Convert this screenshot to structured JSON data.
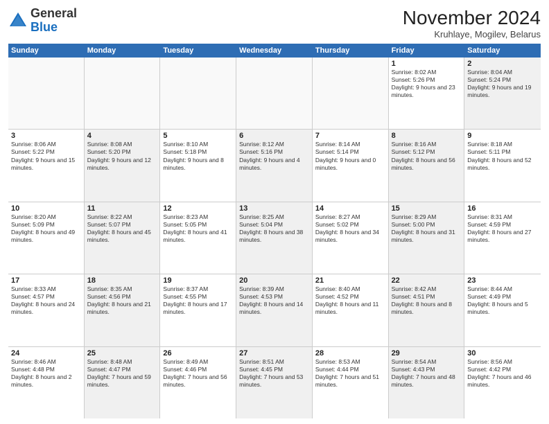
{
  "header": {
    "logo_general": "General",
    "logo_blue": "Blue",
    "month_title": "November 2024",
    "subtitle": "Kruhlaye, Mogilev, Belarus"
  },
  "days_of_week": [
    "Sunday",
    "Monday",
    "Tuesday",
    "Wednesday",
    "Thursday",
    "Friday",
    "Saturday"
  ],
  "rows": [
    [
      {
        "day": "",
        "info": "",
        "shaded": false,
        "empty": true
      },
      {
        "day": "",
        "info": "",
        "shaded": false,
        "empty": true
      },
      {
        "day": "",
        "info": "",
        "shaded": false,
        "empty": true
      },
      {
        "day": "",
        "info": "",
        "shaded": false,
        "empty": true
      },
      {
        "day": "",
        "info": "",
        "shaded": false,
        "empty": true
      },
      {
        "day": "1",
        "info": "Sunrise: 8:02 AM\nSunset: 5:26 PM\nDaylight: 9 hours and 23 minutes.",
        "shaded": false,
        "empty": false
      },
      {
        "day": "2",
        "info": "Sunrise: 8:04 AM\nSunset: 5:24 PM\nDaylight: 9 hours and 19 minutes.",
        "shaded": true,
        "empty": false
      }
    ],
    [
      {
        "day": "3",
        "info": "Sunrise: 8:06 AM\nSunset: 5:22 PM\nDaylight: 9 hours and 15 minutes.",
        "shaded": false,
        "empty": false
      },
      {
        "day": "4",
        "info": "Sunrise: 8:08 AM\nSunset: 5:20 PM\nDaylight: 9 hours and 12 minutes.",
        "shaded": true,
        "empty": false
      },
      {
        "day": "5",
        "info": "Sunrise: 8:10 AM\nSunset: 5:18 PM\nDaylight: 9 hours and 8 minutes.",
        "shaded": false,
        "empty": false
      },
      {
        "day": "6",
        "info": "Sunrise: 8:12 AM\nSunset: 5:16 PM\nDaylight: 9 hours and 4 minutes.",
        "shaded": true,
        "empty": false
      },
      {
        "day": "7",
        "info": "Sunrise: 8:14 AM\nSunset: 5:14 PM\nDaylight: 9 hours and 0 minutes.",
        "shaded": false,
        "empty": false
      },
      {
        "day": "8",
        "info": "Sunrise: 8:16 AM\nSunset: 5:12 PM\nDaylight: 8 hours and 56 minutes.",
        "shaded": true,
        "empty": false
      },
      {
        "day": "9",
        "info": "Sunrise: 8:18 AM\nSunset: 5:11 PM\nDaylight: 8 hours and 52 minutes.",
        "shaded": false,
        "empty": false
      }
    ],
    [
      {
        "day": "10",
        "info": "Sunrise: 8:20 AM\nSunset: 5:09 PM\nDaylight: 8 hours and 49 minutes.",
        "shaded": false,
        "empty": false
      },
      {
        "day": "11",
        "info": "Sunrise: 8:22 AM\nSunset: 5:07 PM\nDaylight: 8 hours and 45 minutes.",
        "shaded": true,
        "empty": false
      },
      {
        "day": "12",
        "info": "Sunrise: 8:23 AM\nSunset: 5:05 PM\nDaylight: 8 hours and 41 minutes.",
        "shaded": false,
        "empty": false
      },
      {
        "day": "13",
        "info": "Sunrise: 8:25 AM\nSunset: 5:04 PM\nDaylight: 8 hours and 38 minutes.",
        "shaded": true,
        "empty": false
      },
      {
        "day": "14",
        "info": "Sunrise: 8:27 AM\nSunset: 5:02 PM\nDaylight: 8 hours and 34 minutes.",
        "shaded": false,
        "empty": false
      },
      {
        "day": "15",
        "info": "Sunrise: 8:29 AM\nSunset: 5:00 PM\nDaylight: 8 hours and 31 minutes.",
        "shaded": true,
        "empty": false
      },
      {
        "day": "16",
        "info": "Sunrise: 8:31 AM\nSunset: 4:59 PM\nDaylight: 8 hours and 27 minutes.",
        "shaded": false,
        "empty": false
      }
    ],
    [
      {
        "day": "17",
        "info": "Sunrise: 8:33 AM\nSunset: 4:57 PM\nDaylight: 8 hours and 24 minutes.",
        "shaded": false,
        "empty": false
      },
      {
        "day": "18",
        "info": "Sunrise: 8:35 AM\nSunset: 4:56 PM\nDaylight: 8 hours and 21 minutes.",
        "shaded": true,
        "empty": false
      },
      {
        "day": "19",
        "info": "Sunrise: 8:37 AM\nSunset: 4:55 PM\nDaylight: 8 hours and 17 minutes.",
        "shaded": false,
        "empty": false
      },
      {
        "day": "20",
        "info": "Sunrise: 8:39 AM\nSunset: 4:53 PM\nDaylight: 8 hours and 14 minutes.",
        "shaded": true,
        "empty": false
      },
      {
        "day": "21",
        "info": "Sunrise: 8:40 AM\nSunset: 4:52 PM\nDaylight: 8 hours and 11 minutes.",
        "shaded": false,
        "empty": false
      },
      {
        "day": "22",
        "info": "Sunrise: 8:42 AM\nSunset: 4:51 PM\nDaylight: 8 hours and 8 minutes.",
        "shaded": true,
        "empty": false
      },
      {
        "day": "23",
        "info": "Sunrise: 8:44 AM\nSunset: 4:49 PM\nDaylight: 8 hours and 5 minutes.",
        "shaded": false,
        "empty": false
      }
    ],
    [
      {
        "day": "24",
        "info": "Sunrise: 8:46 AM\nSunset: 4:48 PM\nDaylight: 8 hours and 2 minutes.",
        "shaded": false,
        "empty": false
      },
      {
        "day": "25",
        "info": "Sunrise: 8:48 AM\nSunset: 4:47 PM\nDaylight: 7 hours and 59 minutes.",
        "shaded": true,
        "empty": false
      },
      {
        "day": "26",
        "info": "Sunrise: 8:49 AM\nSunset: 4:46 PM\nDaylight: 7 hours and 56 minutes.",
        "shaded": false,
        "empty": false
      },
      {
        "day": "27",
        "info": "Sunrise: 8:51 AM\nSunset: 4:45 PM\nDaylight: 7 hours and 53 minutes.",
        "shaded": true,
        "empty": false
      },
      {
        "day": "28",
        "info": "Sunrise: 8:53 AM\nSunset: 4:44 PM\nDaylight: 7 hours and 51 minutes.",
        "shaded": false,
        "empty": false
      },
      {
        "day": "29",
        "info": "Sunrise: 8:54 AM\nSunset: 4:43 PM\nDaylight: 7 hours and 48 minutes.",
        "shaded": true,
        "empty": false
      },
      {
        "day": "30",
        "info": "Sunrise: 8:56 AM\nSunset: 4:42 PM\nDaylight: 7 hours and 46 minutes.",
        "shaded": false,
        "empty": false
      }
    ]
  ]
}
